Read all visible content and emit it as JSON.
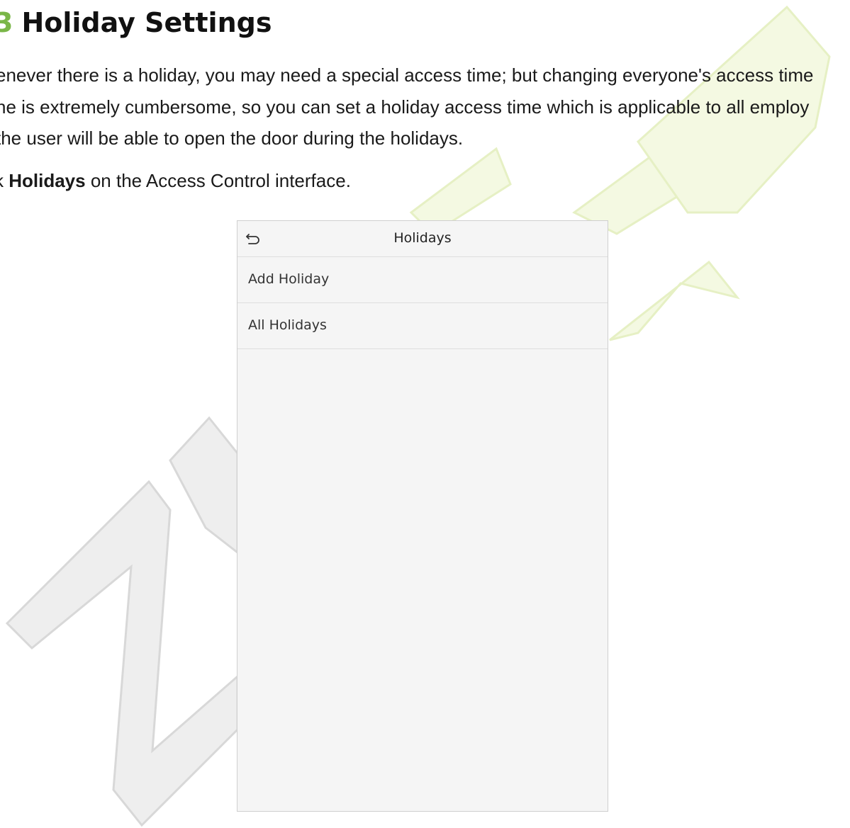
{
  "section": {
    "number": "3",
    "title": "Holiday Settings"
  },
  "intro_lines": [
    "enever there is a holiday, you may need a special access time; but changing everyone's access time",
    "ne is extremely cumbersome, so you can set a holiday access time which is applicable to all employ",
    "the user will be able to open the door during the holidays."
  ],
  "instruction": {
    "prefix": "k ",
    "bold": "Holidays",
    "suffix": " on the Access Control interface."
  },
  "device": {
    "back_icon": "back-arrow-icon",
    "title": "Holidays",
    "menu_items": [
      {
        "label": "Add Holiday"
      },
      {
        "label": "All Holidays"
      }
    ]
  },
  "colors": {
    "section_number": "#7ab648",
    "watermark_gray": "#d6d6d6",
    "watermark_yellow": "#eaf5c8"
  }
}
